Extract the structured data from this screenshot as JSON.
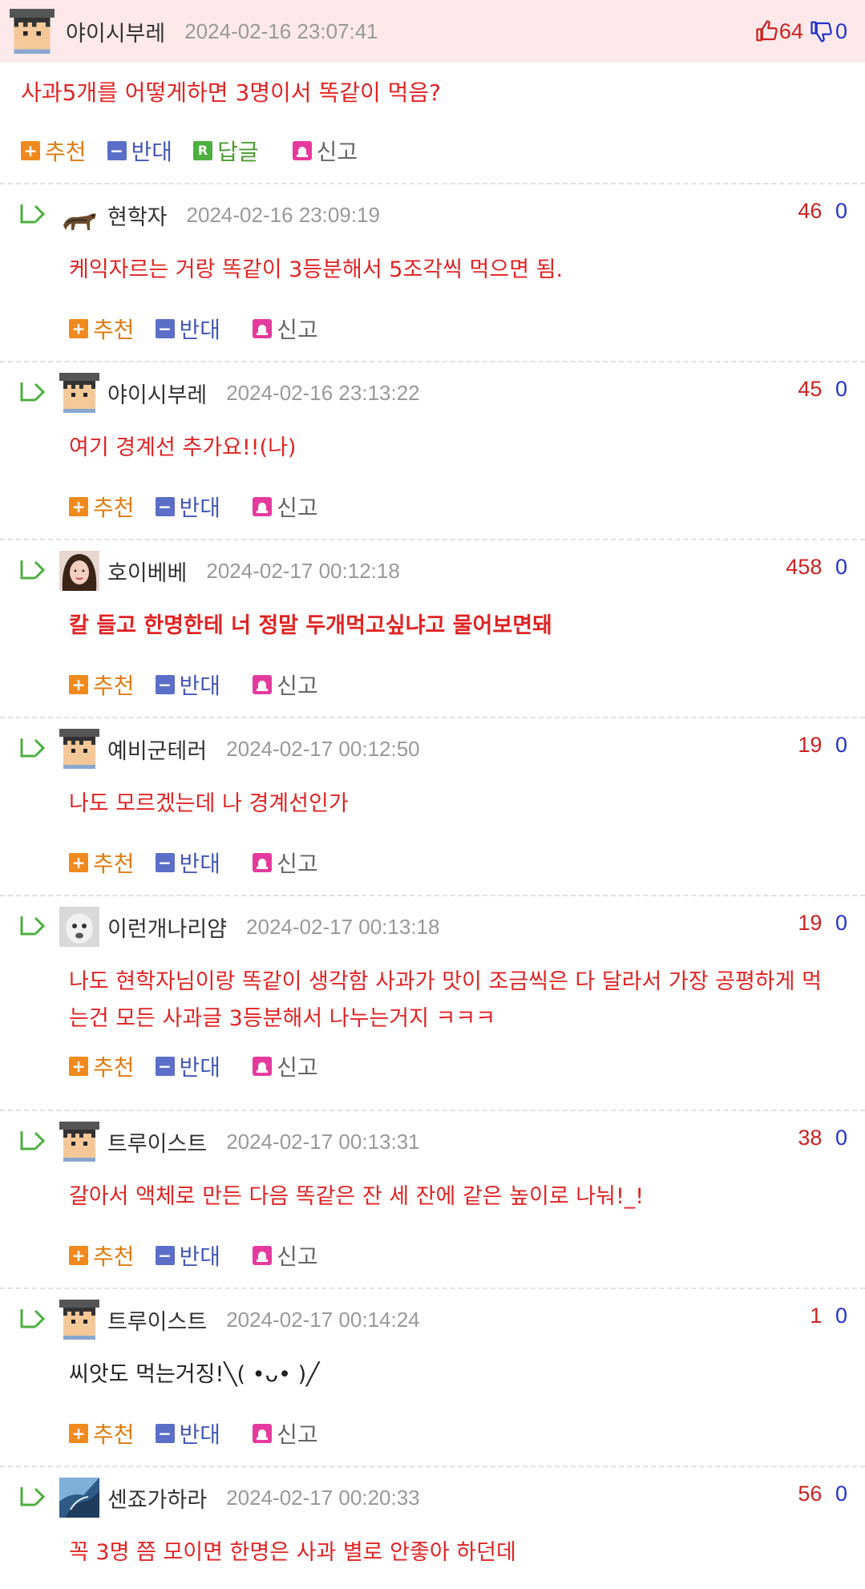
{
  "post": {
    "nick": "야이시부레",
    "date": "2024-02-16 23:07:41",
    "up": "64",
    "down": "0",
    "title": "사과5개를 어떻게하면 3명이서 똑같이 먹음?",
    "actions": {
      "up": "추천",
      "down": "반대",
      "reply": "답글",
      "report": "신고"
    }
  },
  "comment_actions": {
    "up": "추천",
    "down": "반대",
    "report": "신고"
  },
  "comments": [
    {
      "nick": "현학자",
      "date": "2024-02-16 23:09:19",
      "up": "46",
      "down": "0",
      "text": "케익자르는 거랑 똑같이 3등분해서 5조각씩 먹으면 됨.",
      "avatar": "dog-avatar"
    },
    {
      "nick": "야이시부레",
      "date": "2024-02-16 23:13:22",
      "up": "45",
      "down": "0",
      "text": "여기 경계선 추가요!!(나)",
      "avatar": "pixel-avatar"
    },
    {
      "nick": "호이베베",
      "date": "2024-02-17 00:12:18",
      "up": "458",
      "down": "0",
      "text": "칼 들고 한명한테 너 정말 두개먹고싶냐고 물어보면돼",
      "avatar": "photo-avatar"
    },
    {
      "nick": "예비군테러",
      "date": "2024-02-17 00:12:50",
      "up": "19",
      "down": "0",
      "text": "나도 모르겠는데 나 경계선인가",
      "avatar": "pixel-avatar"
    },
    {
      "nick": "이런개나리얌",
      "date": "2024-02-17 00:13:18",
      "up": "19",
      "down": "0",
      "text": "나도 현학자님이랑 똑같이 생각함 사과가 맛이 조금씩은 다 달라서 가장 공평하게 먹는건 모든 사과글 3등분해서 나누는거지 ㅋㅋㅋ",
      "avatar": "baby-avatar"
    },
    {
      "nick": "트루이스트",
      "date": "2024-02-17 00:13:31",
      "up": "38",
      "down": "0",
      "text": "갈아서 액체로 만든 다음 똑같은 잔 세 잔에 같은 높이로 나눠!_!",
      "avatar": "pixel-avatar"
    },
    {
      "nick": "트루이스트",
      "date": "2024-02-17 00:14:24",
      "up": "1",
      "down": "0",
      "text": "씨앗도 먹는거징!╲( •ᴗ• )╱",
      "avatar": "pixel-avatar"
    },
    {
      "nick": "센죠가하라",
      "date": "2024-02-17 00:20:33",
      "up": "56",
      "down": "0",
      "text": "꼭 3명 쯤 모이면 한명은 사과 별로 안좋아 하던데",
      "avatar": "anime-avatar"
    }
  ],
  "colors": {
    "accent_red": "#e02424",
    "up_red": "#cc2222",
    "down_blue": "#2233cc",
    "header_bg": "#fde9ea",
    "recommend_orange": "#f08a1e",
    "oppose_blue": "#5b6fc8",
    "reply_green": "#4caf3f",
    "report_pink": "#e53a9d"
  }
}
